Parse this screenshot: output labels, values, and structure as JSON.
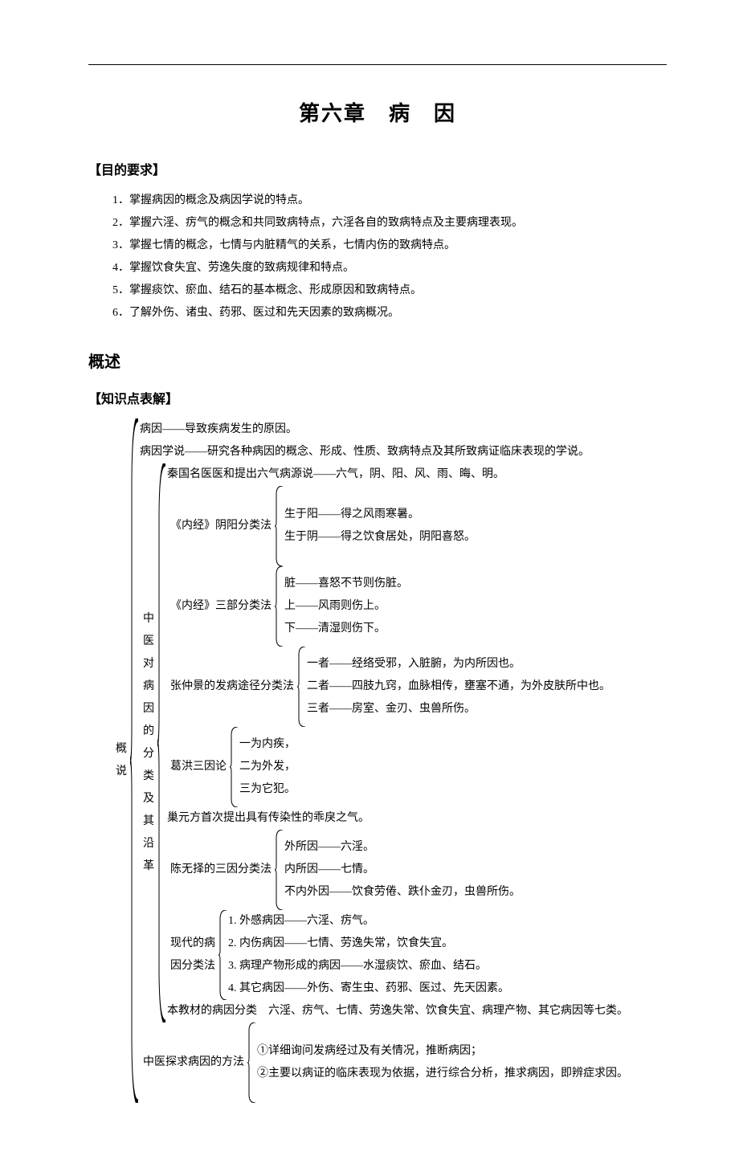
{
  "chapter_title": "第六章　病　因",
  "headings": {
    "objectives": "【目的要求】",
    "overview": "概述",
    "knowledge": "【知识点表解】"
  },
  "objectives": [
    "1．掌握病因的概念及病因学说的特点。",
    "2．掌握六淫、疠气的概念和共同致病特点，六淫各自的致病特点及主要病理表现。",
    "3．掌握七情的概念，七情与内脏精气的关系，七情内伤的致病特点。",
    "4．掌握饮食失宜、劳逸失度的致病规律和特点。",
    "5．掌握痰饮、瘀血、结石的基本概念、形成原因和致病特点。",
    "6．了解外伤、诸虫、药邪、医过和先天因素的致病概况。"
  ],
  "tree": {
    "root_label": "概\n\n说",
    "top_lines": [
      "病因——导致疾病发生的原因。",
      "病因学说——研究各种病因的概念、形成、性质、致病特点及其所致病证临床表现的学说。"
    ],
    "mid_label": "中\n医\n对\n病\n因\n的\n分\n类\n及\n其\n沿\n革",
    "mid_children": [
      {
        "type": "line",
        "text": "秦国名医医和提出六气病源说——六气，阴、阳、风、雨、晦、明。"
      },
      {
        "type": "group",
        "label": "《内经》阴阳分类法",
        "items": [
          "生于阳——得之风雨寒暑。",
          "生于阴——得之饮食居处，阴阳喜怒。"
        ]
      },
      {
        "type": "group",
        "label": "《内经》三部分类法",
        "items": [
          "脏——喜怒不节则伤脏。",
          "上——风雨则伤上。",
          "下——清湿则伤下。"
        ]
      },
      {
        "type": "group",
        "label": "张仲景的发病途径分类法",
        "items": [
          "一者——经络受邪，入脏腑，为内所因也。",
          "二者——四肢九窍，血脉相传，壅塞不通，为外皮肤所中也。",
          "三者——房室、金刃、虫兽所伤。"
        ]
      },
      {
        "type": "group",
        "label": "葛洪三因论",
        "items": [
          "一为内疾，",
          "二为外发，",
          "三为它犯。"
        ]
      },
      {
        "type": "line",
        "text": "巢元方首次提出具有传染性的乖戾之气。"
      },
      {
        "type": "group",
        "label": "陈无择的三因分类法",
        "items": [
          "外所因——六淫。",
          "内所因——七情。",
          "不内外因——饮食劳倦、跌仆金刃，虫兽所伤。"
        ]
      },
      {
        "type": "group",
        "label": "现代的病\n因分类法",
        "items": [
          "1. 外感病因——六淫、疠气。",
          "2. 内伤病因——七情、劳逸失常，饮食失宜。",
          "3. 病理产物形成的病因——水湿痰饮、瘀血、结石。",
          "4. 其它病因——外伤、寄生虫、药邪、医过、先天因素。"
        ]
      },
      {
        "type": "line",
        "text": "本教材的病因分类　六淫、疠气、七情、劳逸失常、饮食失宜、病理产物、其它病因等七类。"
      }
    ],
    "methods_label": "中医探求病因的方法",
    "methods_items": [
      "①详细询问发病经过及有关情况，推断病因；",
      "②主要以病证的临床表现为依据，进行综合分析，推求病因，即辨症求因。"
    ]
  }
}
